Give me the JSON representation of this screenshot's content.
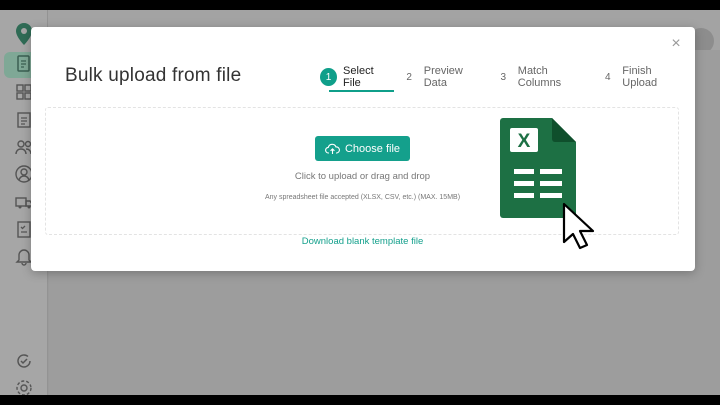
{
  "modal": {
    "title": "Bulk upload from file",
    "close": "×",
    "steps": [
      {
        "number": "1",
        "label": "Select File",
        "active": true
      },
      {
        "number": "2",
        "label": "Preview Data",
        "active": false
      },
      {
        "number": "3",
        "label": "Match Columns",
        "active": false
      },
      {
        "number": "4",
        "label": "Finish Upload",
        "active": false
      }
    ],
    "upload": {
      "button_label": "Choose file",
      "hint": "Click to upload or drag and drop",
      "accepted": "Any spreadsheet file accepted (XLSX, CSV, etc.) (MAX. 15MB)"
    },
    "template_link": "Download blank template file",
    "excel_badge": "X"
  },
  "colors": {
    "accent": "#14a08c",
    "excel_green": "#1d7044"
  },
  "icons": {
    "sidebar": [
      "map-pin-logo-icon",
      "document-icon",
      "dashboard-icon",
      "report-icon",
      "team-icon",
      "user-icon",
      "truck-icon",
      "checklist-icon",
      "bell-icon",
      "check-cycle-icon",
      "settings-icon"
    ],
    "upload": "cloud-upload-icon"
  }
}
